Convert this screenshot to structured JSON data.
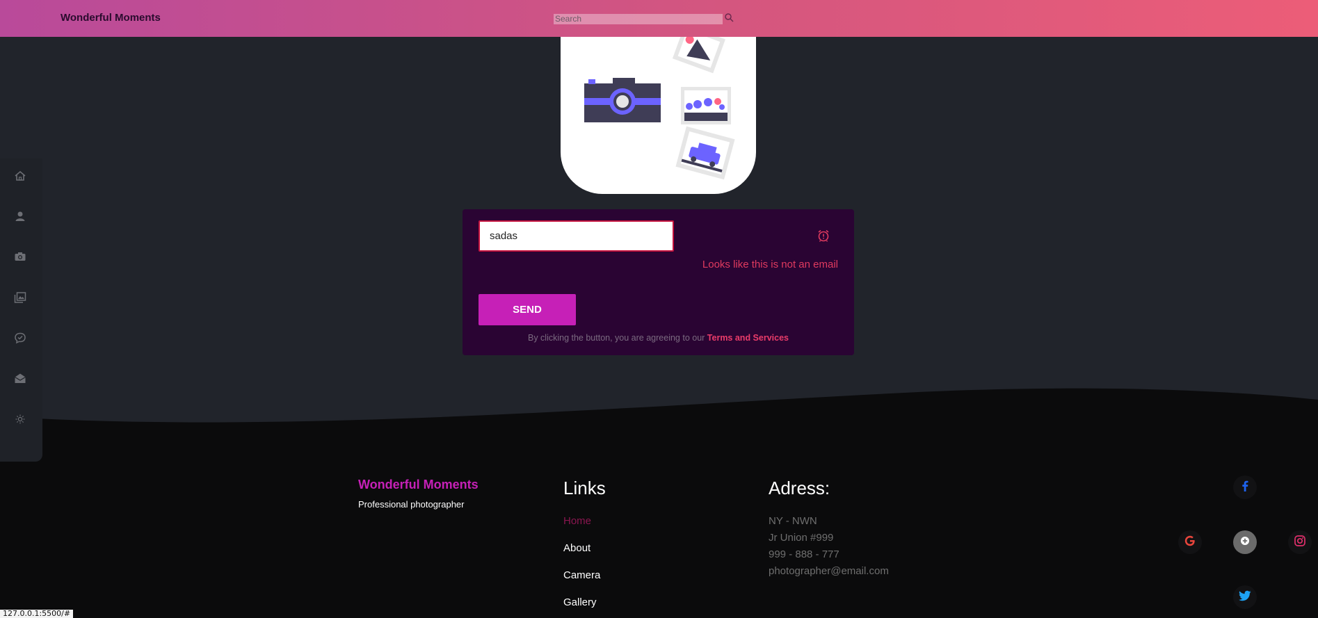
{
  "header": {
    "brand": "Wonderful Moments",
    "search_placeholder": "Search",
    "search_icon": "search-icon"
  },
  "sidebar": {
    "items": [
      {
        "icon": "home-icon"
      },
      {
        "icon": "user-icon"
      },
      {
        "icon": "camera-icon"
      },
      {
        "icon": "gallery-icon"
      },
      {
        "icon": "chat-check-icon"
      },
      {
        "icon": "mail-open-icon"
      },
      {
        "icon": "sun-icon"
      }
    ]
  },
  "form": {
    "email_value": "sadas",
    "error_icon": "alarm-icon",
    "error_message": "Looks like this is not an email",
    "send_label": "SEND",
    "terms_prefix": "By clicking the button, you are agreeing to our",
    "terms_link": "Terms and Services"
  },
  "footer": {
    "brand": "Wonderful Moments",
    "tagline": "Professional photographer",
    "links_title": "Links",
    "links": [
      "Home",
      "About",
      "Camera",
      "Gallery"
    ],
    "address_title": "Adress:",
    "address_lines": [
      "NY - NWN",
      "Jr Union #999",
      "999 - 888 - 777",
      "photographer@email.com"
    ],
    "social": [
      "facebook-icon",
      "google-icon",
      "plus-icon",
      "instagram-icon",
      "twitter-icon"
    ]
  },
  "colors": {
    "accent": "#c620b7",
    "error": "#e03a5f",
    "header_start": "#b94a9a",
    "header_end": "#ec5d78",
    "panel": "#2a0433"
  },
  "status_url": "127.0.0.1:5500/#"
}
